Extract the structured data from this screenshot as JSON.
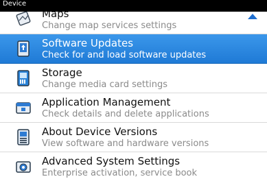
{
  "header": {
    "title": "Device"
  },
  "items": [
    {
      "title": "Maps",
      "subtitle": "Change map services settings",
      "icon": "maps-icon"
    },
    {
      "title": "Software Updates",
      "subtitle": "Check for and load software updates",
      "icon": "software-update-icon",
      "selected": true
    },
    {
      "title": "Storage",
      "subtitle": "Change media card settings",
      "icon": "storage-icon"
    },
    {
      "title": "Application Management",
      "subtitle": "Check details and delete applications",
      "icon": "application-management-icon"
    },
    {
      "title": "About Device Versions",
      "subtitle": "View software and hardware versions",
      "icon": "device-versions-icon"
    },
    {
      "title": "Advanced System Settings",
      "subtitle": "Enterprise activation, service book",
      "icon": "advanced-settings-icon"
    }
  ],
  "colors": {
    "selection": "#1f7ad6",
    "scroll_arrow": "#1f6fd0"
  }
}
